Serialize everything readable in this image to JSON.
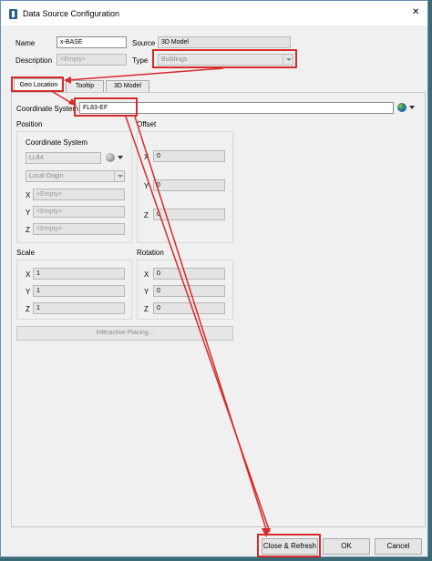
{
  "window": {
    "title": "Data Source Configuration",
    "close_glyph": "✕"
  },
  "form": {
    "name_label": "Name",
    "name_value": "x-BASE",
    "source_label": "Source",
    "source_value": "3D Model",
    "description_label": "Description",
    "description_placeholder": "<Empty>",
    "type_label": "Type",
    "type_value": "Buildings"
  },
  "tabs": [
    {
      "label": "Geo Location"
    },
    {
      "label": "Tooltip"
    },
    {
      "label": "3D Model"
    }
  ],
  "geo": {
    "coord_label": "Coordinate System",
    "coord_value": "FL83-EF",
    "position": {
      "label": "Position",
      "coord_label": "Coordinate System",
      "coord_value": "LL84",
      "origin_value": "Local Origin",
      "x_label": "X",
      "x_placeholder": "<Empty>",
      "y_label": "Y",
      "y_placeholder": "<Empty>",
      "z_label": "Z",
      "z_placeholder": "<Empty>"
    },
    "offset": {
      "label": "Offset",
      "x_label": "X",
      "x_value": "0",
      "y_label": "Y",
      "y_value": "0",
      "z_label": "Z",
      "z_value": "0"
    },
    "scale": {
      "label": "Scale",
      "x_label": "X",
      "x_value": "1",
      "y_label": "Y",
      "y_value": "1",
      "z_label": "Z",
      "z_value": "1"
    },
    "rotation": {
      "label": "Rotation",
      "x_label": "X",
      "x_value": "0",
      "y_label": "Y",
      "y_value": "0",
      "z_label": "Z",
      "z_value": "0"
    },
    "interactive_label": "Interactive Placing..."
  },
  "buttons": {
    "close_refresh": "Close & Refresh",
    "ok": "OK",
    "cancel": "Cancel"
  },
  "annotation_color": "#d62b2b"
}
